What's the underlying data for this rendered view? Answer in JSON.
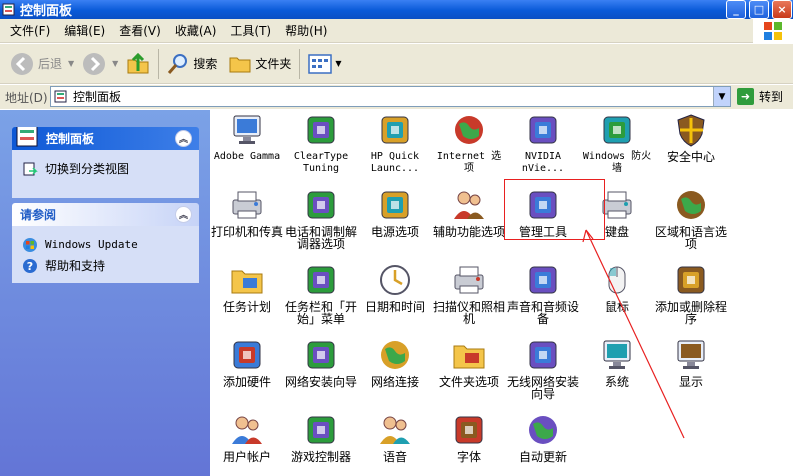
{
  "window": {
    "title": "控制面板",
    "min": "_",
    "max": "□",
    "close": "×"
  },
  "menu": [
    "文件(F)",
    "编辑(E)",
    "查看(V)",
    "收藏(A)",
    "工具(T)",
    "帮助(H)"
  ],
  "toolbar": {
    "back": "后退",
    "search": "搜索",
    "folders": "文件夹"
  },
  "address": {
    "label": "地址(D)",
    "value": "控制面板",
    "go": "转到"
  },
  "sidebar": {
    "panels": [
      {
        "title": "控制面板",
        "links": [
          "切换到分类视图"
        ]
      },
      {
        "title": "请参阅",
        "links": [
          "Windows Update",
          "帮助和支持"
        ]
      }
    ]
  },
  "items": [
    {
      "label": "Adobe Gamma",
      "icon": "monitor-icon"
    },
    {
      "label": "ClearType Tuning",
      "icon": "cleartype-icon"
    },
    {
      "label": "HP Quick Launc...",
      "icon": "rocket-icon"
    },
    {
      "label": "Internet 选项",
      "icon": "globe-icon"
    },
    {
      "label": "NVIDIA nVie...",
      "icon": "nvidia-icon"
    },
    {
      "label": "Windows 防火墙",
      "icon": "firewall-icon"
    },
    {
      "label": "安全中心",
      "icon": "shield-icon"
    },
    {
      "label": "打印机和传真",
      "icon": "printer-icon"
    },
    {
      "label": "电话和调制解调器选项",
      "icon": "phone-icon"
    },
    {
      "label": "电源选项",
      "icon": "power-icon"
    },
    {
      "label": "辅助功能选项",
      "icon": "accessibility-icon"
    },
    {
      "label": "管理工具",
      "icon": "admin-tools-icon"
    },
    {
      "label": "键盘",
      "icon": "keyboard-icon"
    },
    {
      "label": "区域和语言选项",
      "icon": "region-globe-icon"
    },
    {
      "label": "任务计划",
      "icon": "task-folder-icon"
    },
    {
      "label": "任务栏和「开始」菜单",
      "icon": "taskbar-icon"
    },
    {
      "label": "日期和时间",
      "icon": "clock-icon"
    },
    {
      "label": "扫描仪和照相机",
      "icon": "scanner-icon"
    },
    {
      "label": "声音和音频设备",
      "icon": "speaker-icon"
    },
    {
      "label": "鼠标",
      "icon": "mouse-icon"
    },
    {
      "label": "添加或删除程序",
      "icon": "add-remove-icon"
    },
    {
      "label": "添加硬件",
      "icon": "hardware-icon"
    },
    {
      "label": "网络安装向导",
      "icon": "network-house-icon"
    },
    {
      "label": "网络连接",
      "icon": "network-globe-icon"
    },
    {
      "label": "文件夹选项",
      "icon": "folder-options-icon"
    },
    {
      "label": "无线网络安装向导",
      "icon": "wireless-icon"
    },
    {
      "label": "系统",
      "icon": "system-icon"
    },
    {
      "label": "显示",
      "icon": "display-icon"
    },
    {
      "label": "用户帐户",
      "icon": "users-icon"
    },
    {
      "label": "游戏控制器",
      "icon": "gamepad-icon"
    },
    {
      "label": "语音",
      "icon": "speech-icon"
    },
    {
      "label": "字体",
      "icon": "fonts-icon"
    },
    {
      "label": "自动更新",
      "icon": "update-icon"
    }
  ]
}
